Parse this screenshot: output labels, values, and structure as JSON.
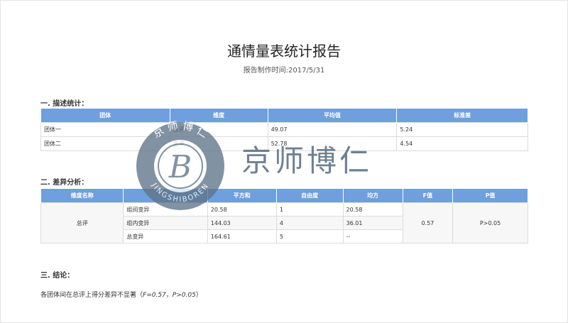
{
  "report": {
    "title": "通情量表统计报告",
    "date_line": "报告制作时间:2017/5/31"
  },
  "descriptive": {
    "heading": "一. 描述统计：",
    "headers": [
      "团体",
      "维度",
      "平均值",
      "标准差"
    ],
    "rows": [
      [
        "团体一",
        "总评",
        "49.07",
        "5.24"
      ],
      [
        "团体二",
        "总评",
        "52.78",
        "4.54"
      ]
    ]
  },
  "anova": {
    "heading": "二. 差异分析：",
    "headers": [
      "维度名称",
      "",
      "平方和",
      "自由度",
      "均方",
      "F值",
      "P值"
    ],
    "dimension": "总评",
    "rows": [
      [
        "组间变异",
        "20.58",
        "1",
        "20.58"
      ],
      [
        "组内变异",
        "144.03",
        "4",
        "36.01"
      ],
      [
        "总变异",
        "164.61",
        "5",
        "--"
      ]
    ],
    "f_value": "0.57",
    "p_value": "P>0.05"
  },
  "conclusion": {
    "heading": "三. 结论：",
    "text_prefix": "各团体间在总评上得分差异不显著（",
    "f_text": "F=0.57",
    "separator": "，",
    "p_text": "P>0.05",
    "text_suffix": "）"
  },
  "watermark": {
    "seal_top": "京 师 博 仁",
    "seal_bottom": "JINGSHIBOREN",
    "seal_letter": "B",
    "brand_text": "京师博仁",
    "color": "#5e7489"
  }
}
